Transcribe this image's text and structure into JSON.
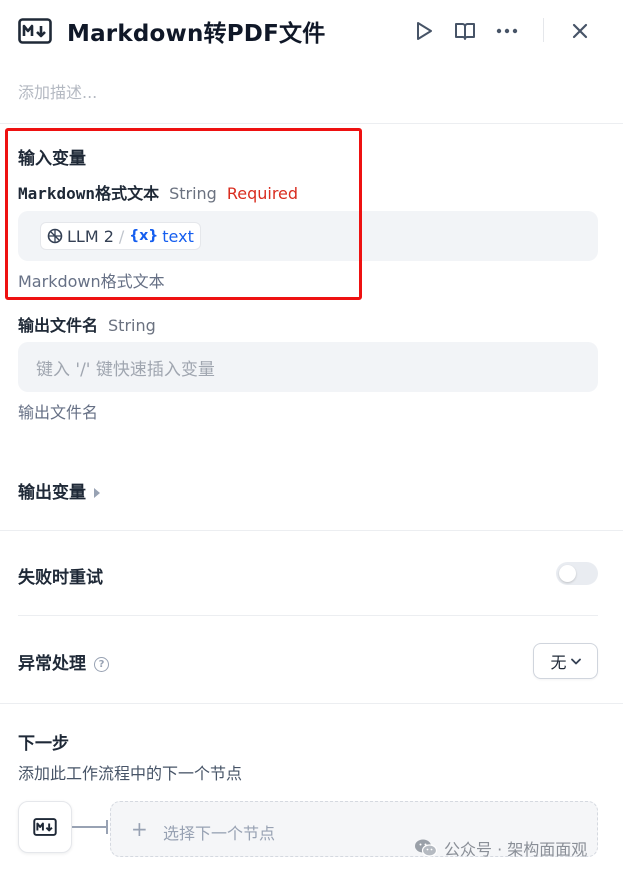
{
  "header": {
    "title": "Markdown转PDF文件",
    "icons": [
      "markdown-icon",
      "play-icon",
      "book-icon",
      "more-icon",
      "close-icon"
    ]
  },
  "description_placeholder": "添加描述...",
  "input_variables": {
    "title": "输入变量",
    "fields": [
      {
        "name": "Markdown格式文本",
        "type": "String",
        "required": "Required",
        "chip": {
          "node": "LLM 2",
          "separator": "/",
          "var_icon": "{x}",
          "var_name": "text"
        },
        "hint": "Markdown格式文本"
      },
      {
        "name": "输出文件名",
        "type": "String",
        "placeholder": "键入 '/' 键快速插入变量",
        "hint": "输出文件名"
      }
    ]
  },
  "output_variables": {
    "title": "输出变量"
  },
  "retry_on_failure": {
    "title": "失败时重试",
    "enabled": false
  },
  "error_handling": {
    "title": "异常处理",
    "help_glyph": "?",
    "value": "无"
  },
  "next_step": {
    "title": "下一步",
    "description": "添加此工作流程中的下一个节点",
    "plus": "+",
    "select_label": "选择下一个节点"
  },
  "watermark": {
    "text": "公众号 · 架构面面观"
  },
  "colors": {
    "required": "#d92d20",
    "variable": "#155eef",
    "highlight_box": "#ee1111"
  }
}
